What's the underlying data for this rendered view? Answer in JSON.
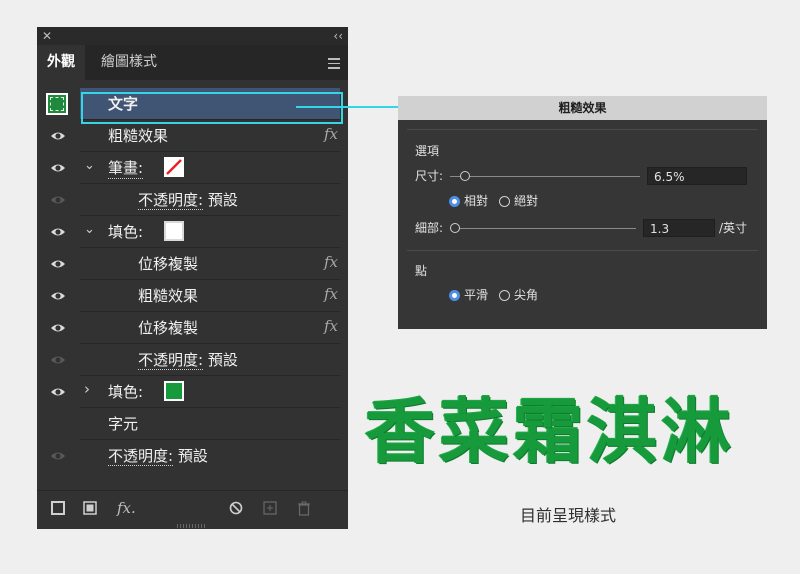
{
  "panel": {
    "tabs": [
      {
        "label": "外觀"
      },
      {
        "label": "繪圖樣式"
      }
    ],
    "rows": [
      {
        "label": "文字",
        "selected": true
      },
      {
        "label": "粗糙效果",
        "fx": "fx"
      },
      {
        "label": "筆畫:",
        "expander": "⌄"
      },
      {
        "label": "不透明度:",
        "value": "預設"
      },
      {
        "label": "填色:",
        "expander": "⌄"
      },
      {
        "label": "位移複製",
        "fx": "fx"
      },
      {
        "label": "粗糙效果",
        "fx": "fx"
      },
      {
        "label": "位移複製",
        "fx": "fx"
      },
      {
        "label": "不透明度:",
        "value": "預設"
      },
      {
        "label": "填色:",
        "expander": "›"
      },
      {
        "label": "字元"
      },
      {
        "label": "不透明度:",
        "value": "預設"
      }
    ],
    "bottom_fx": "fx"
  },
  "dialog": {
    "title": "粗糙效果",
    "options_heading": "選項",
    "size_label": "尺寸:",
    "size_value": "6.5%",
    "relative_label": "相對",
    "absolute_label": "絕對",
    "detail_label": "細部:",
    "detail_value": "1.3",
    "detail_unit": "/英寸",
    "points_heading": "點",
    "smooth_label": "平滑",
    "corner_label": "尖角"
  },
  "preview": {
    "text": "香菜霜淇淋",
    "caption": "目前呈現樣式"
  },
  "colors": {
    "panel_bg": "#323232",
    "selected_row": "#405573",
    "highlight": "#33d5e6",
    "preview_green": "#179a3b",
    "radio_accent": "#4d8fe8"
  }
}
